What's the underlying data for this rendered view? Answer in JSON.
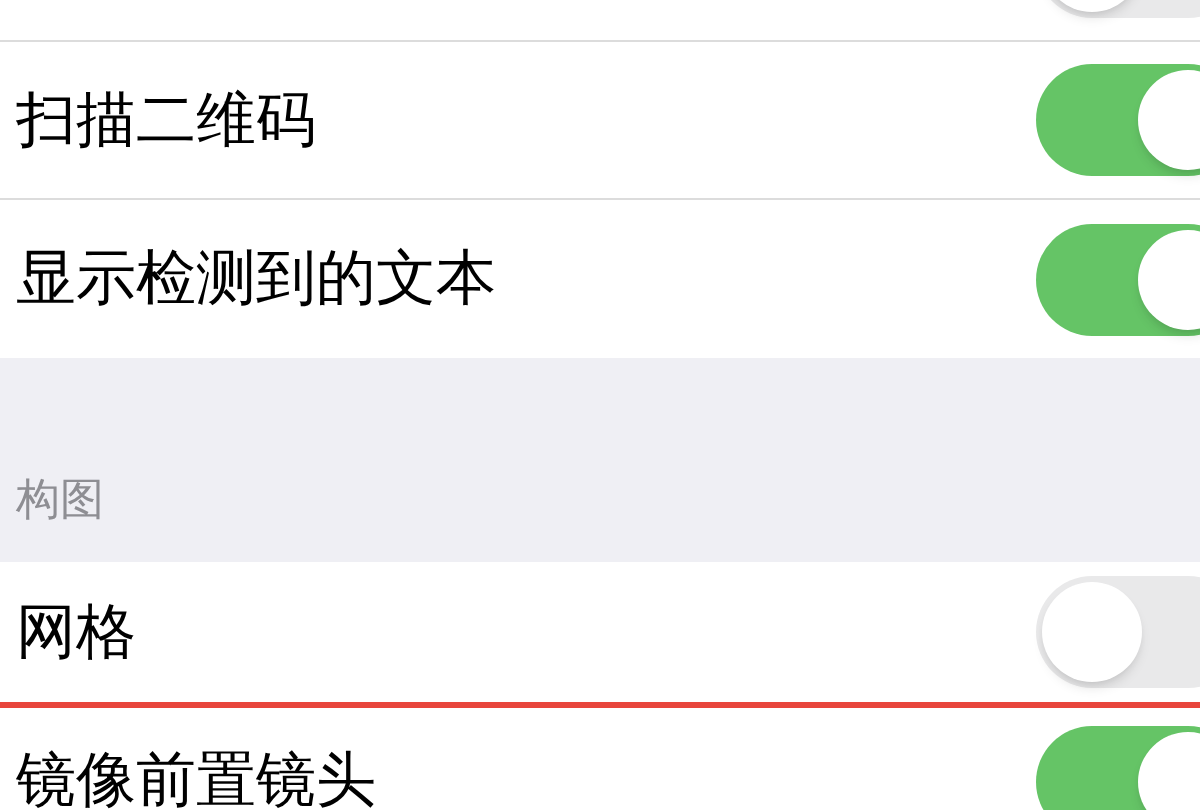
{
  "groups": [
    {
      "rows": [
        {
          "on": false
        },
        {
          "label": "扫描二维码",
          "on": true
        },
        {
          "label": "显示检测到的文本",
          "on": true
        }
      ]
    },
    {
      "header": "构图",
      "rows": [
        {
          "label": "网格",
          "on": false
        },
        {
          "label": "镜像前置镜头",
          "on": true
        }
      ]
    }
  ]
}
